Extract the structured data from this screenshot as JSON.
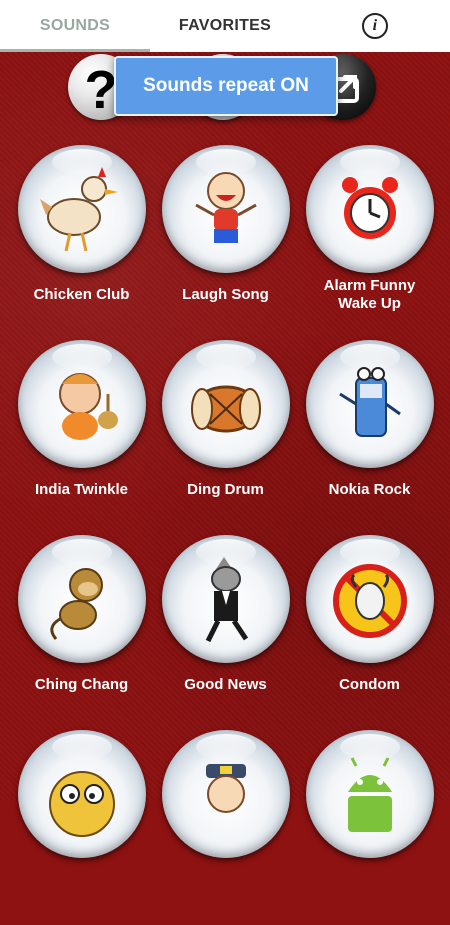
{
  "tabs": {
    "sounds": "SOUNDS",
    "favorites": "FAVORITES",
    "info_glyph": "i"
  },
  "toast": "Sounds repeat ON",
  "top_icons": [
    "help-icon",
    "sound-icon",
    "share-icon"
  ],
  "sounds": [
    {
      "label": "Chicken Club",
      "icon": "chicken-icon"
    },
    {
      "label": "Laugh Song",
      "icon": "laughing-boy-icon"
    },
    {
      "label": "Alarm Funny\nWake Up",
      "icon": "alarm-clock-icon"
    },
    {
      "label": "India Twinkle",
      "icon": "indian-child-icon"
    },
    {
      "label": "Ding Drum",
      "icon": "drum-icon"
    },
    {
      "label": "Nokia Rock",
      "icon": "phone-character-icon"
    },
    {
      "label": "Ching Chang",
      "icon": "monkey-icon"
    },
    {
      "label": "Good News",
      "icon": "wolf-suit-icon"
    },
    {
      "label": "Condom",
      "icon": "bull-icon"
    },
    {
      "label": "",
      "icon": "goofy-face-icon"
    },
    {
      "label": "",
      "icon": "pilot-icon"
    },
    {
      "label": "",
      "icon": "android-robot-icon"
    }
  ],
  "colors": {
    "background": "#8e1111",
    "tab_active": "#9aa7a0",
    "toast": "#5b9be8"
  }
}
